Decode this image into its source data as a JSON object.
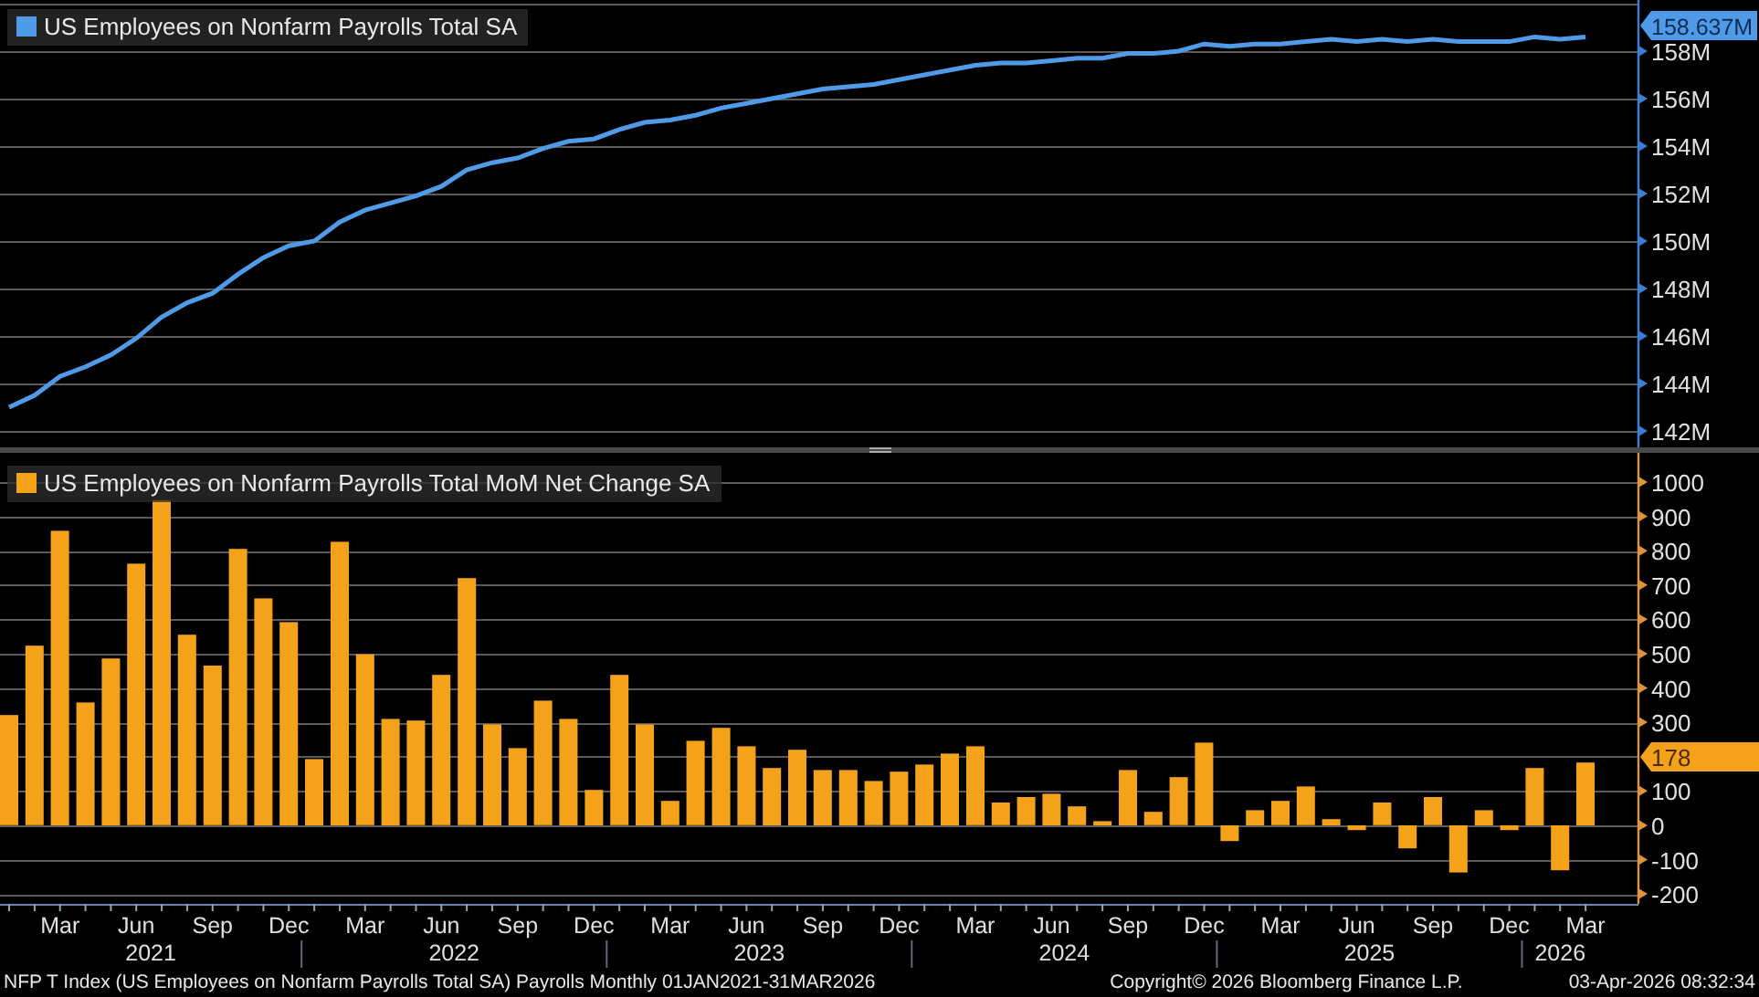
{
  "top_panel": {
    "last_value_tag": "158.637M",
    "chart_data": {
      "type": "line",
      "grid": true,
      "ylim": [
        141.31,
        160.15
      ],
      "yticks": [
        {
          "value": 142,
          "label": "142M"
        },
        {
          "value": 144,
          "label": "144M"
        },
        {
          "value": 146,
          "label": "146M"
        },
        {
          "value": 148,
          "label": "148M"
        },
        {
          "value": 150,
          "label": "150M"
        },
        {
          "value": 152,
          "label": "152M"
        },
        {
          "value": 154,
          "label": "154M"
        },
        {
          "value": 156,
          "label": "156M"
        },
        {
          "value": 158,
          "label": "158M"
        }
      ],
      "series": [
        {
          "name": "US Employees on Nonfarm Payrolls Total SA",
          "color": "#4f9be8",
          "values": [
            143.0,
            143.5,
            144.3,
            144.7,
            145.2,
            145.9,
            146.8,
            147.4,
            147.8,
            148.6,
            149.3,
            149.8,
            150.0,
            150.8,
            151.3,
            151.6,
            151.9,
            152.3,
            153.0,
            153.3,
            153.5,
            153.9,
            154.2,
            154.3,
            154.7,
            155.0,
            155.1,
            155.3,
            155.6,
            155.8,
            156.0,
            156.2,
            156.4,
            156.5,
            156.6,
            156.8,
            157.0,
            157.2,
            157.4,
            157.5,
            157.5,
            157.6,
            157.7,
            157.7,
            157.9,
            157.9,
            158.0,
            158.3,
            158.2,
            158.3,
            158.3,
            158.4,
            158.5,
            158.4,
            158.5,
            158.4,
            158.5,
            158.4,
            158.4,
            158.4,
            158.6,
            158.5,
            158.6
          ]
        }
      ]
    }
  },
  "bottom_panel": {
    "last_value_tag": "178",
    "chart_data": {
      "type": "bar",
      "grid": true,
      "ylim": [
        -229,
        1085
      ],
      "yticks": [
        1000,
        900,
        800,
        700,
        600,
        500,
        400,
        300,
        100,
        0,
        -100,
        -200
      ],
      "series": [
        {
          "name": "US Employees on Nonfarm Payrolls Total MoM Net Change SA",
          "color": "#f5a21b",
          "values": [
            321,
            523,
            858,
            358,
            486,
            762,
            947,
            555,
            465,
            805,
            661,
            592,
            193,
            826,
            498,
            310,
            305,
            438,
            720,
            294,
            225,
            363,
            310,
            103,
            438,
            294,
            71,
            246,
            284,
            230,
            167,
            220,
            161,
            161,
            129,
            156,
            177,
            209,
            230,
            66,
            82,
            92,
            55,
            12,
            161,
            39,
            140,
            241,
            -46,
            44,
            71,
            113,
            18,
            -14,
            66,
            -67,
            82,
            -137,
            44,
            -14,
            167,
            -131,
            183
          ]
        }
      ]
    }
  },
  "x_axis": {
    "month_labels": [
      "Mar",
      "Jun",
      "Sep",
      "Dec",
      "Mar",
      "Jun",
      "Sep",
      "Dec",
      "Mar",
      "Jun",
      "Sep",
      "Dec",
      "Mar",
      "Jun",
      "Sep",
      "Dec",
      "Mar",
      "Jun",
      "Sep",
      "Dec",
      "Mar"
    ],
    "years": [
      "2021",
      "2022",
      "2023",
      "2024",
      "2025",
      "2026"
    ]
  },
  "footer": {
    "description": "NFP T Index (US Employees on Nonfarm Payrolls Total SA) Payrolls Monthly 01JAN2021-31MAR2026",
    "copyright": "Copyright© 2026 Bloomberg Finance L.P.",
    "timestamp": "03-Apr-2026 08:32:34"
  }
}
